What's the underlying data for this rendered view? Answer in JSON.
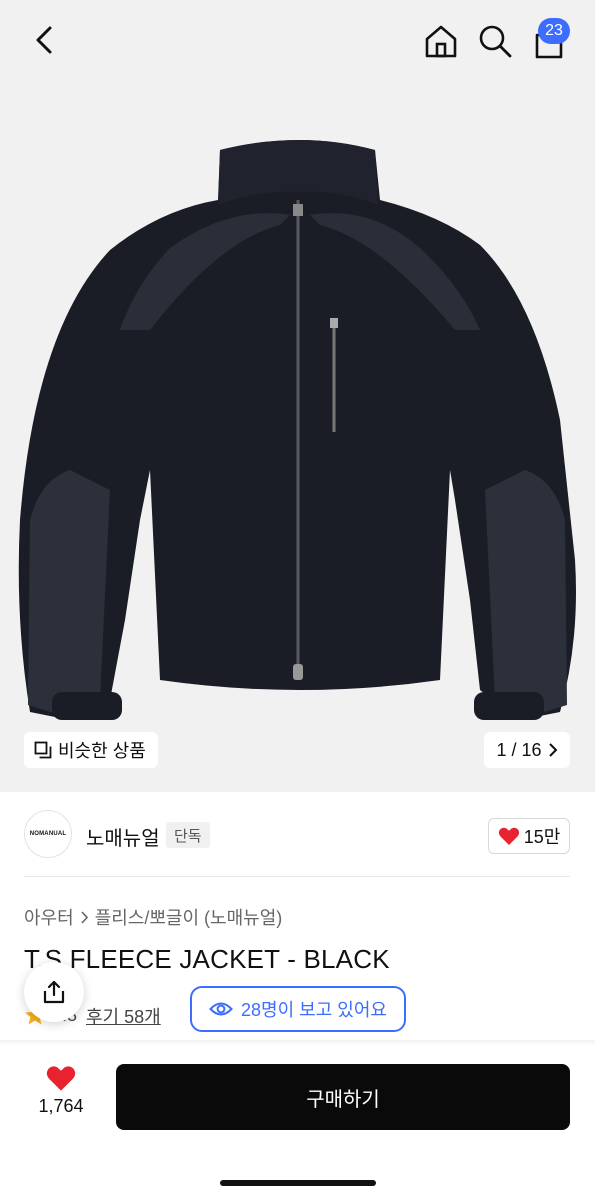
{
  "header": {
    "back_icon": "chevron-left-icon",
    "home_icon": "home-icon",
    "search_icon": "search-icon",
    "cart_icon": "bag-icon",
    "cart_badge": "23",
    "badge_color": "#3d6dff"
  },
  "gallery": {
    "similar_label": "비슷한 상품",
    "counter": "1 / 16",
    "background": "#f1f1f1"
  },
  "store": {
    "logo_text": "NOMANUAL",
    "name": "노매뉴얼",
    "tag": "단독",
    "like_count": "15만"
  },
  "product": {
    "breadcrumb": [
      "아우터",
      "플리스/뽀글이 (노매뉴얼)"
    ],
    "title": "T.S FLEECE JACKET - BLACK",
    "rating": "4.8",
    "reviews": "후기 58개",
    "viewers": "28명이 보고 있어요"
  },
  "bottom": {
    "wish_count": "1,764",
    "buy_label": "구매하기"
  }
}
